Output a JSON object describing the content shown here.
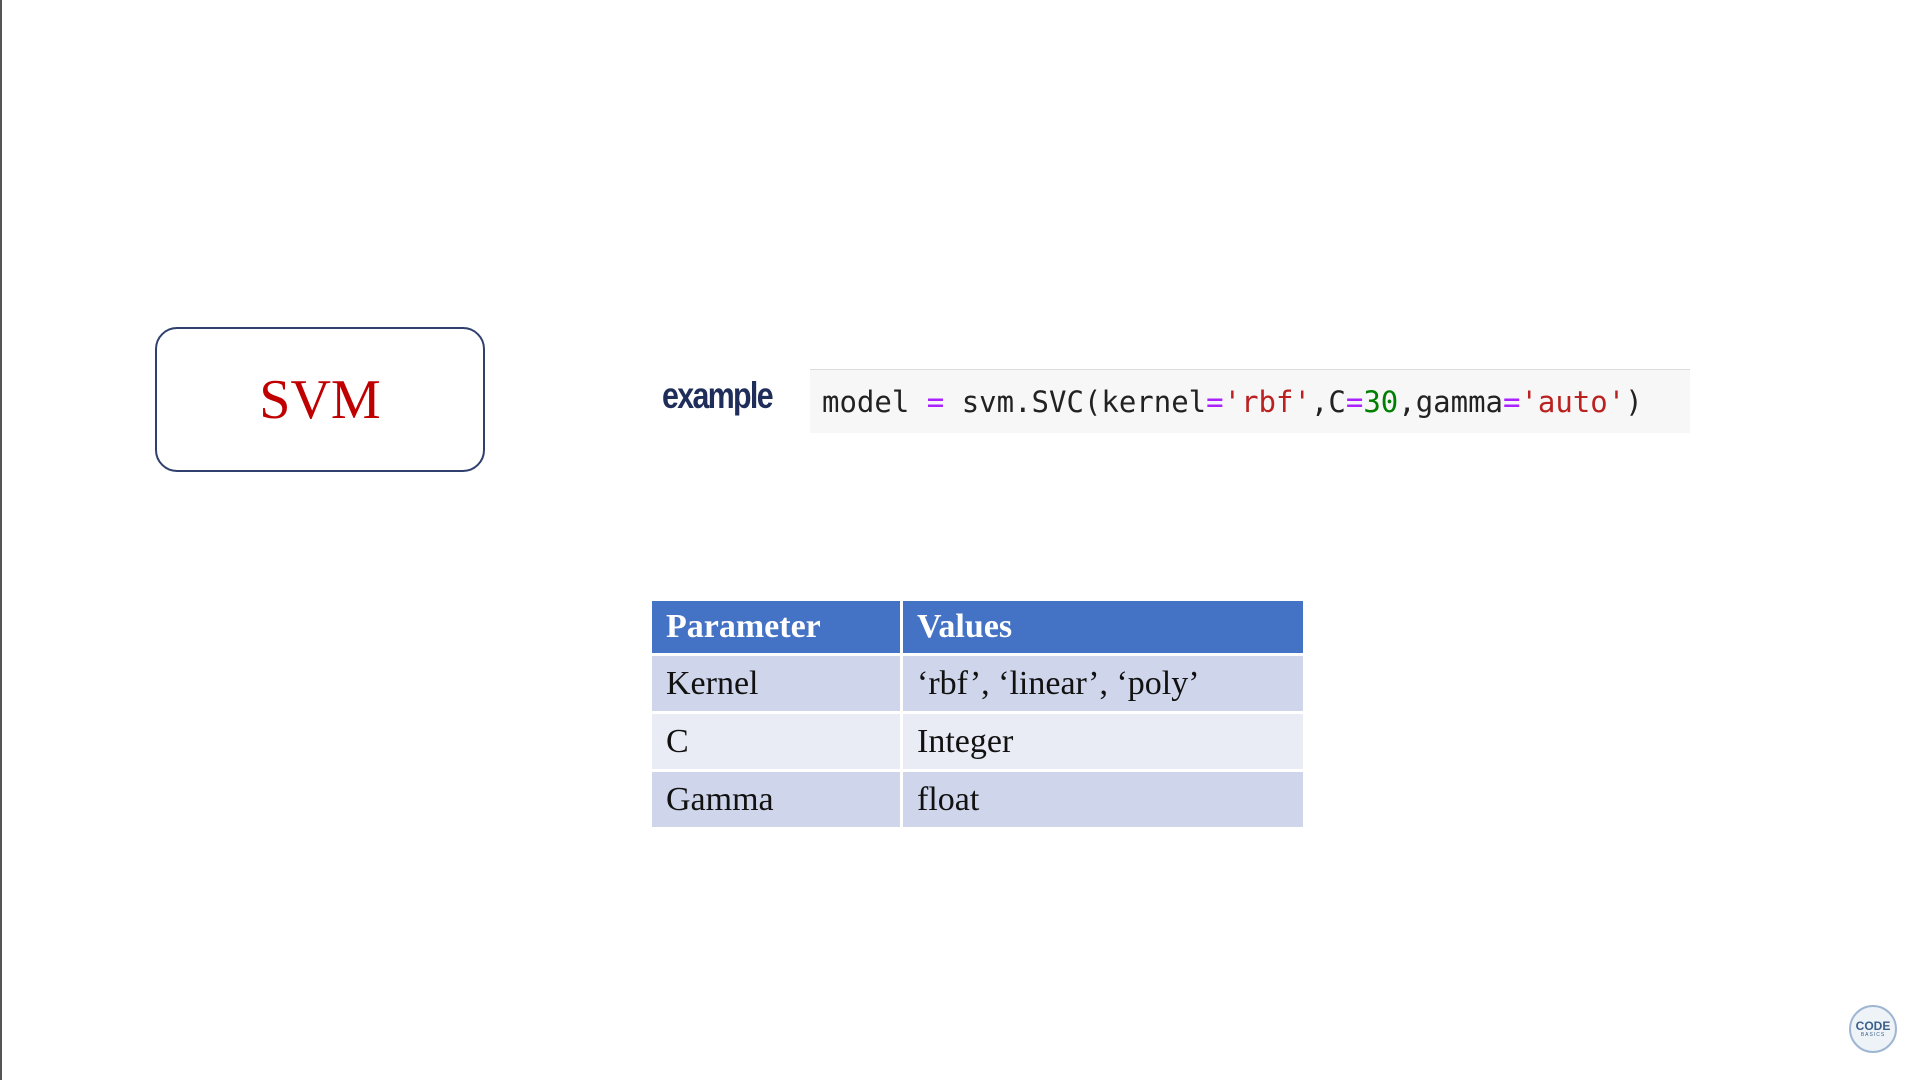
{
  "slide": {
    "model_label": "SVM",
    "example_label": "example",
    "code": {
      "prefix": "model ",
      "assign": "=",
      "call": " svm.SVC(kernel",
      "eq1": "=",
      "kernel_value": "'rbf'",
      "sep1": ",C",
      "eq2": "=",
      "c_value": "30",
      "sep2": ",gamma",
      "eq3": "=",
      "gamma_value": "'auto'",
      "close": ")"
    },
    "table": {
      "headers": [
        "Parameter",
        "Values"
      ],
      "rows": [
        [
          "Kernel",
          "‘rbf’, ‘linear’, ‘poly’"
        ],
        [
          "C",
          "Integer"
        ],
        [
          "Gamma",
          "float"
        ]
      ]
    },
    "logo": {
      "text": "CODE",
      "subtext": "BASICS"
    }
  },
  "colors": {
    "header_bg": "#4472c4",
    "row_odd": "#cfd5ea",
    "row_even": "#e9ebf5",
    "model_text": "#c00000",
    "example_text": "#1f2d5a"
  }
}
